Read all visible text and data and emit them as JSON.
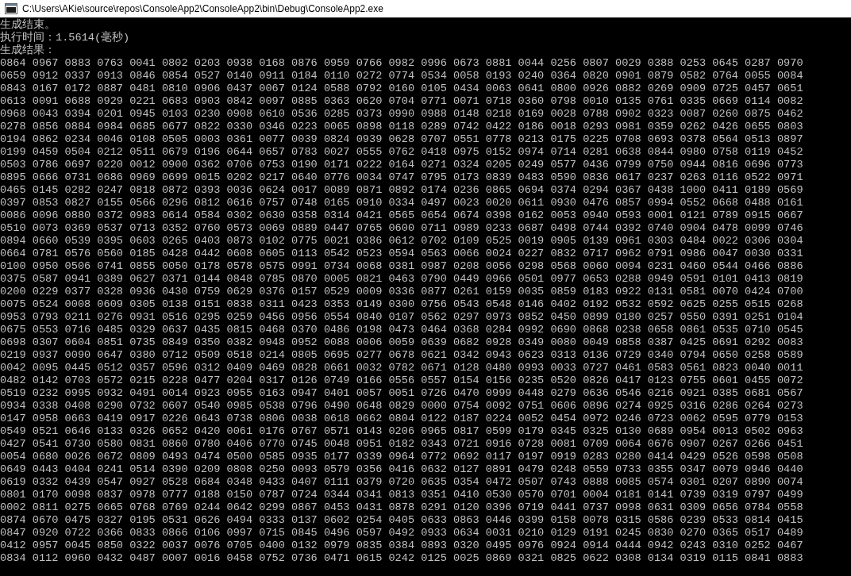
{
  "window": {
    "title": "C:\\Users\\AKie\\source\\repos\\ConsoleApp2\\ConsoleApp2\\bin\\Debug\\ConsoleApp2.exe"
  },
  "console": {
    "lines": [
      "生成结束。",
      "执行时间：1.5614(毫秒)",
      "生成结果：",
      "0864 0967 0883 0763 0041 0802 0203 0938 0168 0876 0959 0766 0982 0996 0673 0881 0044 0256 0807 0029 0388 0253 0645 0287 0970",
      "0659 0912 0337 0913 0846 0854 0527 0140 0911 0184 0110 0272 0774 0534 0058 0193 0240 0364 0820 0901 0879 0582 0764 0055 0084",
      "0843 0167 0172 0887 0481 0810 0906 0437 0067 0124 0588 0792 0160 0105 0434 0063 0641 0800 0926 0882 0269 0909 0725 0457 0651",
      "0613 0091 0688 0929 0221 0683 0903 0842 0097 0885 0363 0620 0704 0771 0071 0718 0360 0798 0010 0135 0761 0335 0669 0114 0082",
      "0968 0043 0394 0201 0945 0103 0230 0908 0610 0536 0285 0373 0990 0988 0148 0218 0169 0028 0788 0902 0323 0087 0260 0875 0462",
      "0278 0856 0884 0984 0685 0677 0822 0330 0346 0223 0065 0898 0118 0289 0742 0422 0186 0018 0293 0981 0359 0262 0426 0655 0803",
      "0194 0862 0234 0046 0108 0505 0003 0361 0077 0039 0824 0939 0628 0707 0551 0778 0213 0175 0225 0708 0693 0378 0564 0513 0897",
      "0199 0459 0504 0212 0511 0679 0196 0644 0657 0783 0027 0555 0762 0418 0975 0152 0974 0714 0281 0638 0844 0980 0758 0119 0452",
      "0503 0786 0697 0220 0012 0900 0362 0706 0753 0190 0171 0222 0164 0271 0324 0205 0249 0577 0436 0799 0750 0944 0816 0696 0773",
      "0895 0666 0731 0686 0969 0699 0015 0202 0217 0640 0776 0034 0747 0795 0173 0839 0483 0590 0836 0617 0237 0263 0116 0522 0971",
      "0465 0145 0282 0247 0818 0872 0393 0036 0624 0017 0089 0871 0892 0174 0236 0865 0694 0374 0294 0367 0438 1000 0411 0189 0569",
      "0397 0853 0827 0155 0566 0296 0812 0616 0757 0748 0165 0910 0334 0497 0023 0020 0611 0930 0476 0857 0994 0552 0668 0488 0161",
      "0086 0096 0880 0372 0983 0614 0584 0302 0630 0358 0314 0421 0565 0654 0674 0398 0162 0053 0940 0593 0001 0121 0789 0915 0667",
      "0510 0073 0369 0537 0713 0352 0760 0573 0069 0889 0447 0765 0600 0711 0989 0233 0687 0498 0744 0392 0740 0904 0478 0099 0746",
      "0894 0660 0539 0395 0603 0265 0403 0873 0102 0775 0021 0386 0612 0702 0109 0525 0019 0905 0139 0961 0303 0484 0022 0306 0304",
      "0664 0781 0576 0560 0185 0428 0442 0608 0605 0113 0542 0523 0594 0563 0066 0024 0227 0832 0717 0962 0791 0986 0047 0030 0331",
      "0100 0950 0506 0741 0855 0050 0178 0578 0575 0991 0734 0068 0381 0987 0208 0056 0298 0568 0060 0094 0231 0460 0544 0466 0886",
      "0375 0587 0941 0389 0627 0371 0144 0848 0785 0870 0005 0821 0463 0790 0449 0966 0501 0977 0653 0288 0949 0591 0101 0413 0819",
      "0200 0229 0377 0328 0936 0430 0759 0629 0376 0157 0529 0009 0336 0877 0261 0159 0035 0859 0183 0922 0131 0581 0070 0424 0700",
      "0075 0524 0008 0609 0305 0138 0151 0838 0311 0423 0353 0149 0300 0756 0543 0548 0146 0402 0192 0532 0592 0625 0255 0515 0268",
      "0953 0793 0211 0276 0931 0516 0295 0259 0456 0956 0554 0840 0107 0562 0297 0973 0852 0450 0899 0180 0257 0550 0391 0251 0104",
      "0675 0553 0716 0485 0329 0637 0435 0815 0468 0370 0486 0198 0473 0464 0368 0284 0992 0690 0868 0238 0658 0861 0535 0710 0545",
      "0698 0307 0604 0851 0735 0849 0350 0382 0948 0952 0088 0006 0059 0639 0682 0928 0349 0080 0049 0858 0387 0425 0691 0292 0083",
      "0219 0937 0090 0647 0380 0712 0509 0518 0214 0805 0695 0277 0678 0621 0342 0943 0623 0313 0136 0729 0340 0794 0650 0258 0589",
      "0042 0095 0445 0512 0357 0596 0312 0409 0469 0828 0661 0032 0782 0671 0128 0480 0993 0033 0727 0461 0583 0561 0823 0040 0011",
      "0482 0142 0703 0572 0215 0228 0477 0204 0317 0126 0749 0166 0556 0557 0154 0156 0235 0520 0826 0417 0123 0755 0601 0455 0072",
      "0519 0232 0995 0932 0491 0014 0923 0955 0163 0947 0401 0057 0051 0726 0470 0999 0448 0279 0636 0546 0216 0921 0385 0681 0567",
      "0934 0338 0408 0290 0732 0607 0540 0985 0538 0796 0490 0648 0829 0000 0754 0092 0751 0606 0896 0274 0925 0316 0286 0264 0273",
      "0147 0958 0663 0419 0917 0226 0643 0738 0806 0038 0618 0662 0804 0122 0187 0224 0052 0454 0972 0246 0723 0062 0595 0779 0153",
      "0549 0521 0646 0133 0326 0652 0420 0061 0176 0767 0571 0143 0206 0965 0817 0599 0179 0345 0325 0130 0689 0954 0013 0502 0963",
      "0427 0541 0730 0580 0831 0860 0780 0406 0770 0745 0048 0951 0182 0343 0721 0916 0728 0081 0709 0064 0676 0907 0267 0266 0451",
      "0054 0680 0026 0672 0809 0493 0474 0500 0585 0935 0177 0339 0964 0772 0692 0117 0197 0919 0283 0280 0414 0429 0526 0598 0508",
      "0649 0443 0404 0241 0514 0390 0209 0808 0250 0093 0579 0356 0416 0632 0127 0891 0479 0248 0559 0733 0355 0347 0079 0946 0440",
      "0619 0332 0439 0547 0927 0528 0684 0348 0433 0407 0111 0379 0720 0635 0354 0472 0507 0743 0888 0085 0574 0301 0207 0890 0074",
      "0801 0170 0098 0837 0978 0777 0188 0150 0787 0724 0344 0341 0813 0351 0410 0530 0570 0701 0004 0181 0141 0739 0319 0797 0499",
      "0002 0811 0275 0665 0768 0769 0244 0642 0299 0867 0453 0431 0878 0291 0120 0396 0719 0441 0737 0998 0631 0309 0656 0784 0558",
      "0874 0670 0475 0327 0195 0531 0626 0494 0333 0137 0602 0254 0405 0633 0863 0446 0399 0158 0078 0315 0586 0239 0533 0814 0415",
      "0847 0920 0722 0366 0833 0866 0106 0997 0715 0845 0496 0597 0492 0933 0634 0031 0210 0129 0191 0245 0830 0270 0365 0517 0489",
      "0412 0957 0045 0850 0322 0037 0076 0705 0400 0132 0979 0835 0384 0893 0320 0495 0976 0924 0914 0444 0942 0243 0310 0252 0467",
      "0834 0112 0960 0432 0487 0007 0016 0458 0752 0736 0471 0615 0242 0125 0025 0869 0321 0825 0622 0308 0134 0319 0115 0841 0883"
    ]
  }
}
